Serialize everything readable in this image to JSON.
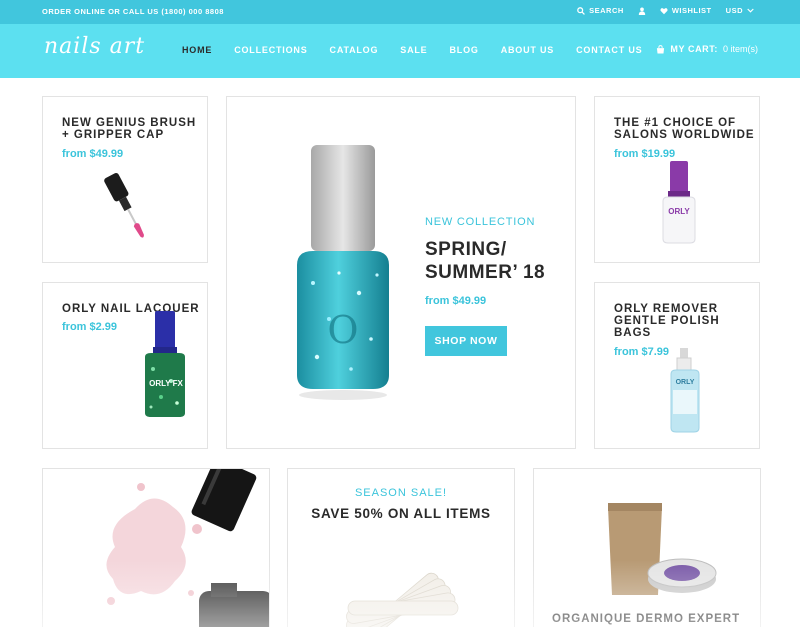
{
  "topbar": {
    "contact": "ORDER ONLINE OR CALL US (1800) 000 8808",
    "search_label": "SEARCH",
    "wishlist_label": "WISHLIST",
    "currency": "USD"
  },
  "header": {
    "logo": "nails art",
    "nav": [
      {
        "label": "HOME",
        "active": true
      },
      {
        "label": "COLLECTIONS"
      },
      {
        "label": "CATALOG"
      },
      {
        "label": "SALE"
      },
      {
        "label": "BLOG"
      },
      {
        "label": "ABOUT US"
      },
      {
        "label": "CONTACT US"
      }
    ],
    "cart_label": "MY CART:",
    "cart_count": "0 item(s)"
  },
  "products": {
    "brush": {
      "title_line1": "NEW GENIUS BRUSH",
      "title_line2": "+ GRIPPER CAP",
      "price": "from $49.99"
    },
    "lacquer": {
      "title": "ORLY NAIL LACQUER",
      "price": "from $2.99",
      "bottle_label": "ORLY FX"
    },
    "choice": {
      "title_line1": "THE #1 CHOICE OF",
      "title_line2": "SALONS WORLDWIDE",
      "price": "from $19.99",
      "bottle_label": "ORLY"
    },
    "remover": {
      "title_line1": "ORLY REMOVER",
      "title_line2": "GENTLE POLISH",
      "title_line3": "BAGS",
      "price": "from $7.99",
      "bottle_label": "ORLY"
    }
  },
  "hero": {
    "tag": "NEW COLLECTION",
    "title_line1": "SPRING/",
    "title_line2": "SUMMER’ 18",
    "price": "from $49.99",
    "button": "SHOP NOW"
  },
  "sale": {
    "tag": "SEASON SALE!",
    "title": "SAVE 50% ON ALL ITEMS"
  },
  "organique": {
    "title": "ORGANIQUE DERMO EXPERT"
  },
  "colors": {
    "accent": "#3bc4db",
    "header_bg": "#5ce0f0",
    "topbar_bg": "#41c6dd"
  }
}
